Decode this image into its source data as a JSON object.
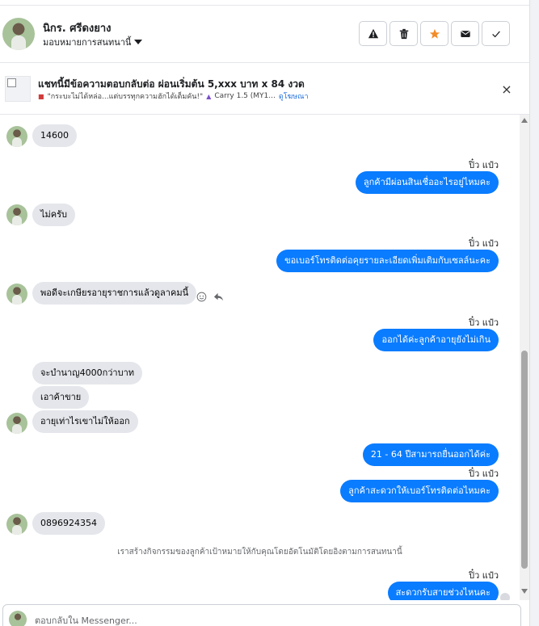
{
  "header": {
    "name": "นิกร. ศรีดงยาง",
    "assign_label": "มอบหมายการสนทนานี้",
    "actions": [
      "warning-icon",
      "trash-icon",
      "star-icon",
      "mail-icon",
      "check-icon"
    ]
  },
  "ad": {
    "title": "แชทนี้มีข้อความตอบกลับต่อ ผ่อนเริ่มต้น 5,xxx บาท x 84 งวด",
    "sub_prefix": "\"กระบะไม่ได้หล่อ...แต่บรรทุกความฮักได้เต็มคัน!\"",
    "sub_car": "Carry 1.5 (MY1...",
    "link": "ดูโฆษณา",
    "close": "×"
  },
  "messages": [
    {
      "dir": "in",
      "text": "14600"
    },
    {
      "dir": "sender",
      "text": "ปิ๋ว แป๋ว"
    },
    {
      "dir": "out",
      "text": "ลูกค้ามีผ่อนสินเชื่ออะไรอยู่ไหมคะ"
    },
    {
      "dir": "in",
      "text": "ไม่ครับ"
    },
    {
      "dir": "sender",
      "text": "ปิ๋ว แป๋ว"
    },
    {
      "dir": "out",
      "text": "ขอเบอร์โทรติดต่อคุยรายละเอียดเพิ่มเติมกับเซลล์นะคะ"
    },
    {
      "dir": "in",
      "text": "พอดีจะเกษียรอายุราชการแล้วดูลาคมนี้"
    },
    {
      "dir": "sender",
      "text": "ปิ๋ว แป๋ว"
    },
    {
      "dir": "out",
      "text": "ออกได้ค่ะลูกค้าอายุยังไม่เกิน"
    },
    {
      "dir": "in",
      "text": "จะบำนาญ4000กว่าบาท"
    },
    {
      "dir": "in",
      "text": "เอาค้าขาย"
    },
    {
      "dir": "in",
      "text": "อายุเท่าไรเขาไม่ให้ออก"
    },
    {
      "dir": "out",
      "text": "21 - 64 ปีสามารถยื่นออกได้ค่ะ"
    },
    {
      "dir": "sender",
      "text": "ปิ๋ว แป๋ว"
    },
    {
      "dir": "out",
      "text": "ลูกค้าสะดวกให้เบอร์โทรติดต่อไหมคะ"
    },
    {
      "dir": "in",
      "text": "0896924354"
    },
    {
      "dir": "meta",
      "text": "เราสร้างกิจกรรมของลูกค้าเป้าหมายให้กับคุณโดยอัตโนมัติโดยอิงตามการสนทนานี้"
    },
    {
      "dir": "sender",
      "text": "ปิ๋ว แป๋ว"
    },
    {
      "dir": "out",
      "text": "สะดวกรับสายช่วงไหนคะ"
    }
  ],
  "composer": {
    "placeholder": "ตอบกลับใน Messenger..."
  },
  "colors": {
    "out_bubble": "#0a7cff",
    "in_bubble": "#e4e6eb",
    "star": "#f28c28"
  }
}
